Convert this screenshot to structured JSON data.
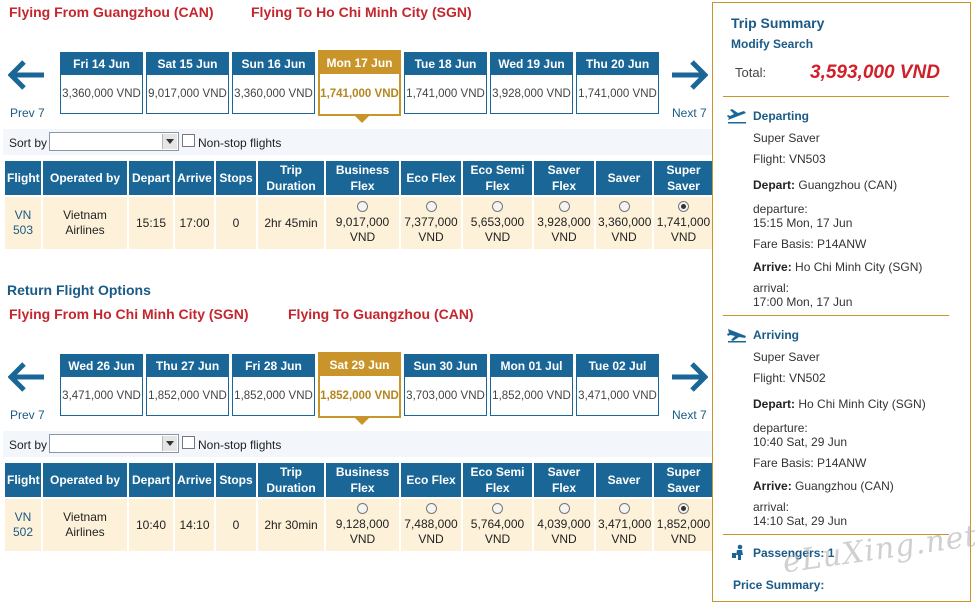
{
  "outbound": {
    "from": "Flying From Guangzhou (CAN)",
    "to": "Flying To Ho Chi Minh City (SGN)",
    "prev": "Prev 7",
    "next": "Next 7",
    "dates": [
      {
        "day": "Fri 14 Jun",
        "price": "3,360,000 VND"
      },
      {
        "day": "Sat 15 Jun",
        "price": "9,017,000 VND"
      },
      {
        "day": "Sun 16 Jun",
        "price": "3,360,000 VND"
      },
      {
        "day": "Mon 17 Jun",
        "price": "1,741,000 VND",
        "selected": true
      },
      {
        "day": "Tue 18 Jun",
        "price": "1,741,000 VND"
      },
      {
        "day": "Wed 19 Jun",
        "price": "3,928,000 VND"
      },
      {
        "day": "Thu 20 Jun",
        "price": "1,741,000 VND"
      }
    ],
    "sort_label": "Sort by",
    "nonstop_label": "Non-stop flights",
    "headers": [
      "Flight",
      "Operated by",
      "Depart",
      "Arrive",
      "Stops",
      "Trip Duration",
      "Business Flex",
      "Eco Flex",
      "Eco Semi Flex",
      "Saver Flex",
      "Saver",
      "Super Saver"
    ],
    "row": {
      "flight": "VN 503",
      "operator": "Vietnam Airlines",
      "depart": "15:15",
      "arrive": "17:00",
      "stops": "0",
      "duration": "2hr 45min",
      "fares": [
        "9,017,000 VND",
        "7,377,000 VND",
        "5,653,000 VND",
        "3,928,000 VND",
        "3,360,000 VND",
        "1,741,000 VND"
      ],
      "selected_fare": 5
    }
  },
  "return": {
    "heading": "Return Flight Options",
    "from": "Flying From Ho Chi Minh City (SGN)",
    "to": "Flying To Guangzhou (CAN)",
    "prev": "Prev 7",
    "next": "Next 7",
    "dates": [
      {
        "day": "Wed 26 Jun",
        "price": "3,471,000 VND"
      },
      {
        "day": "Thu 27 Jun",
        "price": "1,852,000 VND"
      },
      {
        "day": "Fri 28 Jun",
        "price": "1,852,000 VND"
      },
      {
        "day": "Sat 29 Jun",
        "price": "1,852,000 VND",
        "selected": true
      },
      {
        "day": "Sun 30 Jun",
        "price": "3,703,000 VND"
      },
      {
        "day": "Mon 01 Jul",
        "price": "1,852,000 VND"
      },
      {
        "day": "Tue 02 Jul",
        "price": "3,471,000 VND"
      }
    ],
    "sort_label": "Sort by",
    "nonstop_label": "Non-stop flights",
    "headers": [
      "Flight",
      "Operated by",
      "Depart",
      "Arrive",
      "Stops",
      "Trip Duration",
      "Business Flex",
      "Eco Flex",
      "Eco Semi Flex",
      "Saver Flex",
      "Saver",
      "Super Saver"
    ],
    "row": {
      "flight": "VN 502",
      "operator": "Vietnam Airlines",
      "depart": "10:40",
      "arrive": "14:10",
      "stops": "0",
      "duration": "2hr 30min",
      "fares": [
        "9,128,000 VND",
        "7,488,000 VND",
        "5,764,000 VND",
        "4,039,000 VND",
        "3,471,000 VND",
        "1,852,000 VND"
      ],
      "selected_fare": 5
    }
  },
  "summary": {
    "title": "Trip Summary",
    "modify": "Modify Search",
    "total_label": "Total:",
    "total_value": "3,593,000 VND",
    "departing": {
      "title": "Departing",
      "fare_type": "Super Saver",
      "flight": "Flight: VN503",
      "depart_label": "Depart:",
      "depart_value": "Guangzhou (CAN)",
      "departure_label": "departure:",
      "departure_value": "15:15 Mon, 17 Jun",
      "fare_basis": "Fare Basis: P14ANW",
      "arrive_label": "Arrive:",
      "arrive_value": "Ho Chi Minh City (SGN)",
      "arrival_label": "arrival:",
      "arrival_value": "17:00 Mon, 17 Jun"
    },
    "arriving": {
      "title": "Arriving",
      "fare_type": "Super Saver",
      "flight": "Flight: VN502",
      "depart_label": "Depart:",
      "depart_value": "Ho Chi Minh City (SGN)",
      "departure_label": "departure:",
      "departure_value": "10:40 Sat, 29 Jun",
      "fare_basis": "Fare Basis: P14ANW",
      "arrive_label": "Arrive:",
      "arrive_value": "Guangzhou (CAN)",
      "arrival_label": "arrival:",
      "arrival_value": "14:10 Sat, 29 Jun"
    },
    "passengers": "Passengers: 1",
    "price_summary": "Price Summary:"
  },
  "watermark": "eLuXing.net",
  "colors": {
    "header_blue": "#1a6797",
    "gold": "#c9952b",
    "red": "#c4262e",
    "row_bg": "#fdf2d9"
  }
}
